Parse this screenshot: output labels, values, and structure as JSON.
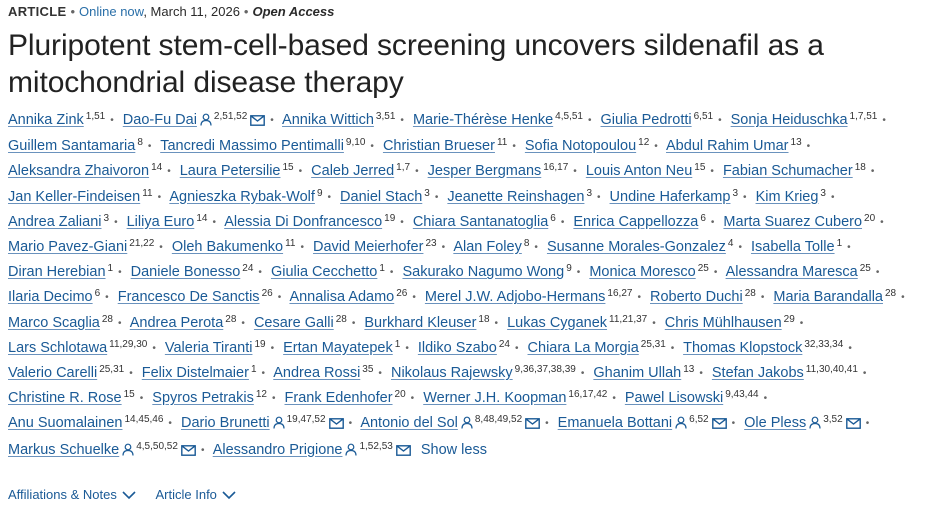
{
  "meta": {
    "article_type": "ARTICLE",
    "online_text": "Online now",
    "date": ", March 11, 2026",
    "access": "Open Access"
  },
  "title": "Pluripotent stem-cell-based screening uncovers sildenafil as a mitochondrial disease therapy",
  "authors": [
    {
      "name": "Annika Zink",
      "sup": "1,51"
    },
    {
      "name": "Dao-Fu Dai",
      "sup": "2,51,52",
      "corresponding": true
    },
    {
      "name": "Annika Wittich",
      "sup": "3,51"
    },
    {
      "name": "Marie-Thérèse Henke",
      "sup": "4,5,51"
    },
    {
      "name": "Giulia Pedrotti",
      "sup": "6,51"
    },
    {
      "name": "Sonja Heiduschka",
      "sup": "1,7,51"
    },
    {
      "name": "Guillem Santamaria",
      "sup": "8"
    },
    {
      "name": "Tancredi Massimo Pentimalli",
      "sup": "9,10"
    },
    {
      "name": "Christian Brueser",
      "sup": "11"
    },
    {
      "name": "Sofia Notopoulou",
      "sup": "12"
    },
    {
      "name": "Abdul Rahim Umar",
      "sup": "13"
    },
    {
      "name": "Aleksandra Zhaivoron",
      "sup": "14"
    },
    {
      "name": "Laura Petersilie",
      "sup": "15"
    },
    {
      "name": "Caleb Jerred",
      "sup": "1,7"
    },
    {
      "name": "Jesper Bergmans",
      "sup": "16,17"
    },
    {
      "name": "Louis Anton Neu",
      "sup": "15"
    },
    {
      "name": "Fabian Schumacher",
      "sup": "18"
    },
    {
      "name": "Jan Keller-Findeisen",
      "sup": "11"
    },
    {
      "name": "Agnieszka Rybak-Wolf",
      "sup": "9"
    },
    {
      "name": "Daniel Stach",
      "sup": "3"
    },
    {
      "name": "Jeanette Reinshagen",
      "sup": "3"
    },
    {
      "name": "Undine Haferkamp",
      "sup": "3"
    },
    {
      "name": "Kim Krieg",
      "sup": "3"
    },
    {
      "name": "Andrea Zaliani",
      "sup": "3"
    },
    {
      "name": "Liliya Euro",
      "sup": "14"
    },
    {
      "name": "Alessia Di Donfrancesco",
      "sup": "19"
    },
    {
      "name": "Chiara Santanatoglia",
      "sup": "6"
    },
    {
      "name": "Enrica Cappellozza",
      "sup": "6"
    },
    {
      "name": "Marta Suarez Cubero",
      "sup": "20"
    },
    {
      "name": "Mario Pavez-Giani",
      "sup": "21,22"
    },
    {
      "name": "Oleh Bakumenko",
      "sup": "11"
    },
    {
      "name": "David Meierhofer",
      "sup": "23"
    },
    {
      "name": "Alan Foley",
      "sup": "8"
    },
    {
      "name": "Susanne Morales-Gonzalez",
      "sup": "4"
    },
    {
      "name": "Isabella Tolle",
      "sup": "1"
    },
    {
      "name": "Diran Herebian",
      "sup": "1"
    },
    {
      "name": "Daniele Bonesso",
      "sup": "24"
    },
    {
      "name": "Giulia Cecchetto",
      "sup": "1"
    },
    {
      "name": "Sakurako Nagumo Wong",
      "sup": "9"
    },
    {
      "name": "Monica Moresco",
      "sup": "25"
    },
    {
      "name": "Alessandra Maresca",
      "sup": "25"
    },
    {
      "name": "Ilaria Decimo",
      "sup": "6"
    },
    {
      "name": "Francesco De Sanctis",
      "sup": "26"
    },
    {
      "name": "Annalisa Adamo",
      "sup": "26"
    },
    {
      "name": "Merel J.W. Adjobo-Hermans",
      "sup": "16,27"
    },
    {
      "name": "Roberto Duchi",
      "sup": "28"
    },
    {
      "name": "Maria Barandalla",
      "sup": "28"
    },
    {
      "name": "Marco Scaglia",
      "sup": "28"
    },
    {
      "name": "Andrea Perota",
      "sup": "28"
    },
    {
      "name": "Cesare Galli",
      "sup": "28"
    },
    {
      "name": "Burkhard Kleuser",
      "sup": "18"
    },
    {
      "name": "Lukas Cyganek",
      "sup": "11,21,37"
    },
    {
      "name": "Chris Mühlhausen",
      "sup": "29"
    },
    {
      "name": "Lars Schlotawa",
      "sup": "11,29,30"
    },
    {
      "name": "Valeria Tiranti",
      "sup": "19"
    },
    {
      "name": "Ertan Mayatepek",
      "sup": "1"
    },
    {
      "name": "Ildiko Szabo",
      "sup": "24"
    },
    {
      "name": "Chiara La Morgia",
      "sup": "25,31"
    },
    {
      "name": "Thomas Klopstock",
      "sup": "32,33,34"
    },
    {
      "name": "Valerio Carelli",
      "sup": "25,31"
    },
    {
      "name": "Felix Distelmaier",
      "sup": "1"
    },
    {
      "name": "Andrea Rossi",
      "sup": "35"
    },
    {
      "name": "Nikolaus Rajewsky",
      "sup": "9,36,37,38,39"
    },
    {
      "name": "Ghanim Ullah",
      "sup": "13"
    },
    {
      "name": "Stefan Jakobs",
      "sup": "11,30,40,41"
    },
    {
      "name": "Christine R. Rose",
      "sup": "15"
    },
    {
      "name": "Spyros Petrakis",
      "sup": "12"
    },
    {
      "name": "Frank Edenhofer",
      "sup": "20"
    },
    {
      "name": "Werner J.H. Koopman",
      "sup": "16,17,42"
    },
    {
      "name": "Pawel Lisowski",
      "sup": "9,43,44"
    },
    {
      "name": "Anu Suomalainen",
      "sup": "14,45,46"
    },
    {
      "name": "Dario Brunetti",
      "sup": "19,47,52",
      "corresponding": true
    },
    {
      "name": "Antonio del Sol",
      "sup": "8,48,49,52",
      "corresponding": true
    },
    {
      "name": "Emanuela Bottani",
      "sup": "6,52",
      "corresponding": true
    },
    {
      "name": "Ole Pless",
      "sup": "3,52",
      "corresponding": true
    },
    {
      "name": "Markus Schuelke",
      "sup": "4,5,50,52",
      "corresponding": true
    },
    {
      "name": "Alessandro Prigione",
      "sup": "1,52,53",
      "corresponding": true
    }
  ],
  "show_less": "Show less",
  "footer": {
    "affiliations": "Affiliations & Notes",
    "article_info": "Article Info"
  },
  "icons": {
    "person": "person-icon",
    "mail": "mail-icon",
    "chevron": "chevron-down-icon"
  },
  "colors": {
    "link": "#1a5a96",
    "text": "#222222"
  }
}
